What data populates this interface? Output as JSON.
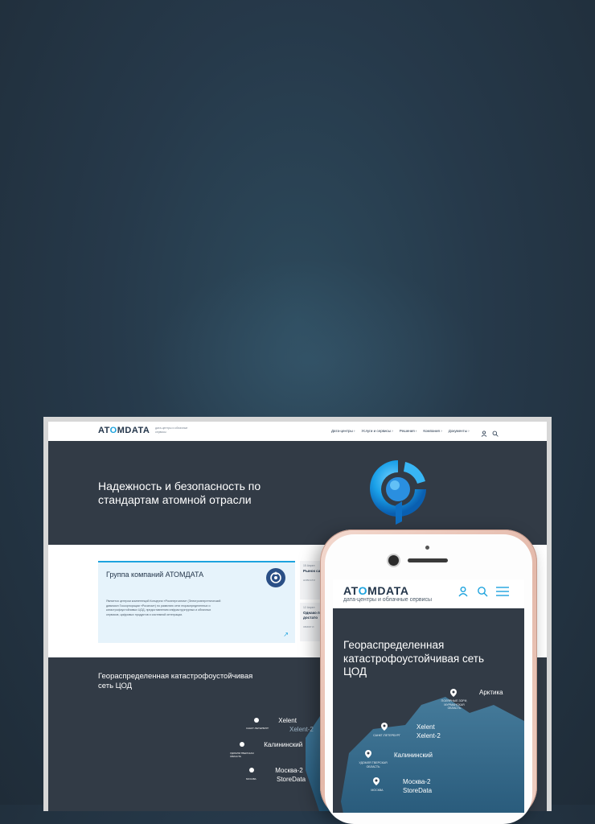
{
  "desktop": {
    "logo": {
      "pre": "AT",
      "o": "O",
      "post": "MDATA"
    },
    "tagline": "дата-центры и облачные сервисы",
    "nav": [
      "Дата-центры ›",
      "Услуги и сервисы ›",
      "Решения ›",
      "Компания ›",
      "Документы ›"
    ],
    "hero_title": "Надежность и безопасность по стандартам атомной отрасли",
    "card": {
      "title": "Группа компаний АТОМДАТА",
      "text": "Является центром компетенций Концерна «Росэнергоатом» (Электроэнергетический дивизион Госкорпорации «Росатом») по развитию сети георaспределенных и катастрофоустойчивых ЦОД, предоставлению инфраструктурных и облачных сервисов, цифровых продуктов и системной интеграции.",
      "arrow": "↗"
    },
    "news": [
      {
        "date": "15 Апрел",
        "title": "Рынок самых д",
        "tag": "НОВОСТИ"
      },
      {
        "date": "12 Апрел",
        "title": "Однако перечи достато",
        "tag": "ОБЗОР И"
      }
    ],
    "map_title": "Георaспределенная катастрофоустойчивая сеть ЦОД",
    "map_pins": [
      {
        "label": "Xelent",
        "label2": "Xelent-2",
        "sub": "САНКТ-ПЕТЕРБУРГ"
      },
      {
        "label": "Калининский",
        "sub": "УДОМЛЯ ТВЕРСКАЯ ОБЛАСТЬ"
      },
      {
        "label": "Москва-2",
        "label2": "StoreData",
        "sub": "МОСКВА"
      }
    ]
  },
  "mobile": {
    "logo": {
      "pre": "AT",
      "o": "O",
      "post": "MDATA"
    },
    "tagline": "дата-центры и облачные сервисы",
    "title": "Георaспределенная катастрофоустойчивая сеть ЦОД",
    "pins": [
      {
        "label": "Арктика",
        "sub": "ПОЛЯРНЫЕ ЗОРИ, МУРМАНСКАЯ ОБЛАСТЬ"
      },
      {
        "label": "Xelent",
        "label2": "Xelent-2",
        "sub": "САНКТ-ПЕТЕРБУРГ"
      },
      {
        "label": "Калининский",
        "sub": "УДОМЛЯ ТВЕРСКАЯ ОБЛАСТЬ"
      },
      {
        "label": "Москва-2",
        "label2": "StoreData",
        "sub": "МОСКВА"
      }
    ]
  },
  "colors": {
    "accent": "#1da3de",
    "dark": "#323b46",
    "navy": "#23354a"
  }
}
